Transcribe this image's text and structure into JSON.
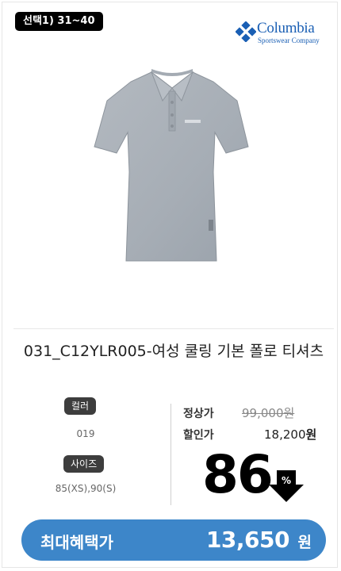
{
  "badge": {
    "text": "선택1) 31~40"
  },
  "brand": {
    "name": "Columbia",
    "tagline": "Sportswear Company"
  },
  "product": {
    "title": "031_C12YLR005-여성 쿨링 기본 폴로 티셔츠",
    "image_icon": "gray-polo-shirt"
  },
  "options": {
    "color_label": "컬러",
    "color_value": "019",
    "size_label": "사이즈",
    "size_value": "85(XS),90(S)"
  },
  "prices": {
    "regular_label": "정상가",
    "regular_value": "99,000원",
    "sale_label": "할인가",
    "sale_value": "18,200",
    "sale_unit": "원"
  },
  "discount": {
    "percent": "86",
    "sign": "%"
  },
  "cta": {
    "label": "최대혜택가",
    "amount": "13,650",
    "unit": "원"
  },
  "colors": {
    "accent": "#3d86c9",
    "brand": "#1a5fb4",
    "shirt": "#a9b0b8"
  }
}
